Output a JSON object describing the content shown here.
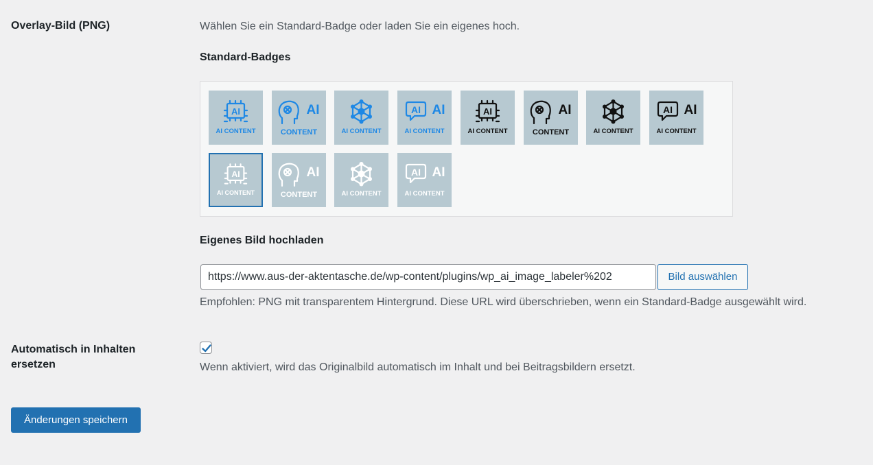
{
  "overlay": {
    "label": "Overlay-Bild (PNG)",
    "description": "Wählen Sie ein Standard-Badge oder laden Sie ein eigenes hoch.",
    "badges_heading": "Standard-Badges",
    "badges": [
      {
        "icon": "chip-icon",
        "color": "#1e88e5",
        "word": "AI",
        "caption": "AI CONTENT",
        "selected": false
      },
      {
        "icon": "brain-icon",
        "color": "#1e88e5",
        "word": "AI",
        "caption": "CONTENT",
        "selected": false
      },
      {
        "icon": "network-icon",
        "color": "#1e88e5",
        "word": "",
        "caption": "AI CONTENT",
        "selected": false
      },
      {
        "icon": "chat-bubble-icon",
        "color": "#1e88e5",
        "word": "AI",
        "caption": "AI CONTENT",
        "selected": false
      },
      {
        "icon": "chip-icon",
        "color": "#111111",
        "word": "AI",
        "caption": "AI CONTENT",
        "selected": false
      },
      {
        "icon": "brain-icon",
        "color": "#111111",
        "word": "AI",
        "caption": "CONTENT",
        "selected": false
      },
      {
        "icon": "network-icon",
        "color": "#111111",
        "word": "",
        "caption": "AI CONTENT",
        "selected": false
      },
      {
        "icon": "chat-bubble-icon",
        "color": "#111111",
        "word": "AI",
        "caption": "AI CONTENT",
        "selected": false
      },
      {
        "icon": "chip-icon",
        "color": "#ffffff",
        "word": "AI",
        "caption": "AI CONTENT",
        "selected": true
      },
      {
        "icon": "brain-icon",
        "color": "#ffffff",
        "word": "AI",
        "caption": "CONTENT",
        "selected": false
      },
      {
        "icon": "network-icon",
        "color": "#ffffff",
        "word": "",
        "caption": "AI CONTENT",
        "selected": false
      },
      {
        "icon": "chat-bubble-icon",
        "color": "#ffffff",
        "word": "AI",
        "caption": "AI CONTENT",
        "selected": false
      }
    ]
  },
  "upload": {
    "heading": "Eigenes Bild hochladen",
    "url_value": "https://www.aus-der-aktentasche.de/wp-content/plugins/wp_ai_image_labeler%202",
    "button_label": "Bild auswählen",
    "hint": "Empfohlen: PNG mit transparentem Hintergrund. Diese URL wird überschrieben, wenn ein Standard-Badge ausgewählt wird."
  },
  "auto_replace": {
    "label": "Automatisch in Inhalten ersetzen",
    "checked": true,
    "description": "Wenn aktiviert, wird das Originalbild automatisch im Inhalt und bei Beitragsbildern ersetzt."
  },
  "save_button": "Änderungen speichern",
  "colors": {
    "accent": "#2271b1",
    "badge_background": "#b7c9d1",
    "page_background": "#f0f0f1"
  }
}
